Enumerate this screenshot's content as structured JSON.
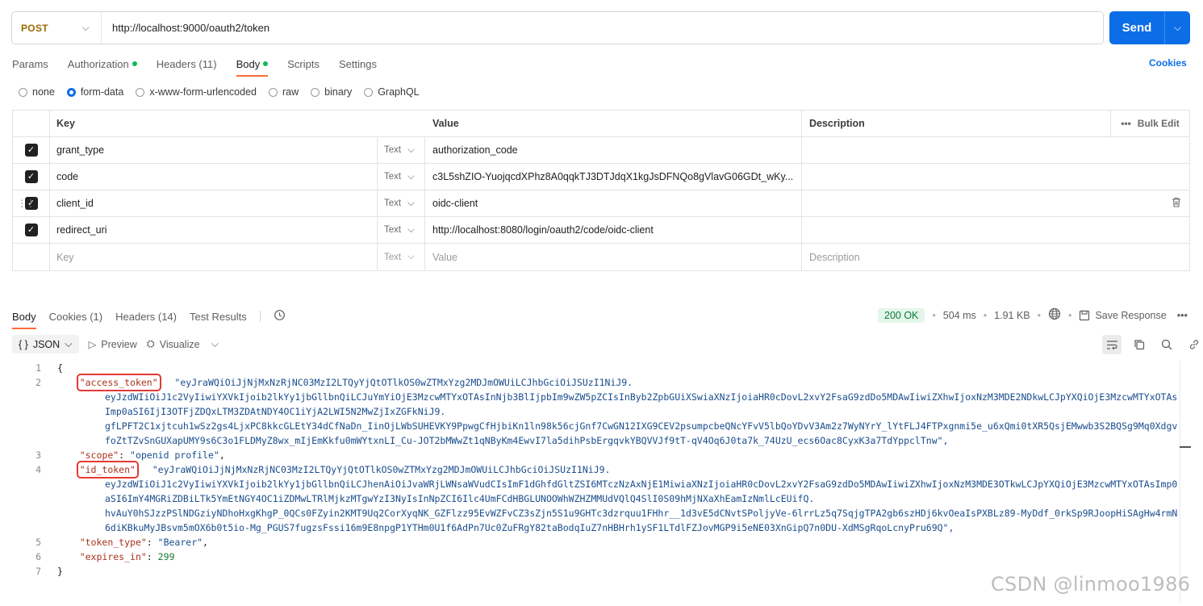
{
  "request": {
    "method": "POST",
    "url": "http://localhost:9000/oauth2/token",
    "send_label": "Send"
  },
  "request_tabs": [
    {
      "label": "Params",
      "dot": false
    },
    {
      "label": "Authorization",
      "dot": true
    },
    {
      "label": "Headers (11)",
      "dot": false
    },
    {
      "label": "Body",
      "dot": true,
      "active": true
    },
    {
      "label": "Scripts",
      "dot": false
    },
    {
      "label": "Settings",
      "dot": false
    }
  ],
  "cookies_label": "Cookies",
  "body_types": [
    {
      "label": "none",
      "selected": false
    },
    {
      "label": "form-data",
      "selected": true
    },
    {
      "label": "x-www-form-urlencoded",
      "selected": false
    },
    {
      "label": "raw",
      "selected": false
    },
    {
      "label": "binary",
      "selected": false
    },
    {
      "label": "GraphQL",
      "selected": false
    }
  ],
  "params_table": {
    "headers": {
      "key": "Key",
      "value": "Value",
      "description": "Description",
      "bulk_edit": "Bulk Edit"
    },
    "rows": [
      {
        "key": "grant_type",
        "type": "Text",
        "value": "authorization_code"
      },
      {
        "key": "code",
        "type": "Text",
        "value": "c3L5shZIO-YuojqcdXPhz8A0qqkTJ3DTJdqX1kgJsDFNQo8gVlavG06GDt_wKy..."
      },
      {
        "key": "client_id",
        "type": "Text",
        "value": "oidc-client"
      },
      {
        "key": "redirect_uri",
        "type": "Text",
        "value": "http://localhost:8080/login/oauth2/code/oidc-client"
      }
    ],
    "placeholder": {
      "key": "Key",
      "type": "Text",
      "value": "Value",
      "description": "Description"
    }
  },
  "response_tabs": [
    {
      "label": "Body",
      "active": true
    },
    {
      "label": "Cookies (1)"
    },
    {
      "label": "Headers (14)"
    },
    {
      "label": "Test Results"
    }
  ],
  "response_meta": {
    "status": "200 OK",
    "time": "504 ms",
    "size": "1.91 KB",
    "save_label": "Save Response"
  },
  "viewer": {
    "format": "JSON",
    "preview_label": "Preview",
    "visualize_label": "Visualize"
  },
  "response_json": {
    "line_numbers": [
      "1",
      "2",
      "3",
      "4",
      "5",
      "6",
      "7"
    ],
    "open_brace": "{",
    "close_brace": "}",
    "access_token_key": "\"access_token\"",
    "access_token_lines": [
      "\"eyJraWQiOiJjNjMxNzRjNC03MzI2LTQyYjQtOTlkOS0wZTMxYzg2MDJmOWUiLCJhbGciOiJSUzI1NiJ9.",
      "eyJzdWIiOiJ1c2VyIiwiYXVkIjoib2lkYy1jbGllbnQiLCJuYmYiOjE3MzcwMTYxOTAsInNjb3BlIjpbIm9wZW5pZCIsInByb2ZpbGUiXSwiaXNzIjoiaHR0cDovL2xvY2FsaG9zdDo5MDAwIiwiZXhwIjoxNzM3MDE2NDkwLCJpYXQiOjE3MzcwMTYxOTAsImp0aSI6IjI3OTFjZDQxLTM3ZDAtNDY4OC1iYjA2LWI5N2MwZjIxZGFkNiJ9.",
      "gfLPFT2C1xjtcuh1wSz2gs4LjxPC8kkcGLEtY34dCfNaDn_IinOjLWbSUHEVKY9PpwgCfHjbiKn1ln98k56cjGnf7CwGN12IXG9CEV2psumpcbeQNcYFvV5lbQoYDvV3Am2z7WyNYrY_lYtFLJ4FTPxgnmi5e_u6xQmi0tXR5QsjEMwwb3S2BQSg9Mq0XdgvfoZtTZvSnGUXapUMY9s6C3o1FLDMyZ8wx_mIjEmKkfu0mWYtxnLI_Cu-JOT2bMWwZt1qNByKm4EwvI7la5dihPsbErgqvkYBQVVJf9tT-qV4Oq6J0ta7k_74UzU_ecs6Oac8CyxK3a7TdYppclTnw\","
    ],
    "scope_key": "\"scope\"",
    "scope_value": "\"openid profile\"",
    "id_token_key": "\"id_token\"",
    "id_token_lines": [
      "\"eyJraWQiOiJjNjMxNzRjNC03MzI2LTQyYjQtOTlkOS0wZTMxYzg2MDJmOWUiLCJhbGciOiJSUzI1NiJ9.",
      "eyJzdWIiOiJ1c2VyIiwiYXVkIjoib2lkYy1jbGllbnQiLCJhenAiOiJvaWRjLWNsaWVudCIsImF1dGhfdGltZSI6MTczNzAxNjE1MiwiaXNzIjoiaHR0cDovL2xvY2FsaG9zdDo5MDAwIiwiZXhwIjoxNzM3MDE3OTkwLCJpYXQiOjE3MzcwMTYxOTAsImp0aSI6ImY4MGRiZDBiLTk5YmEtNGY4OC1iZDMwLTRlMjkzMTgwYzI3NyIsInNpZCI6Ilc4UmFCdHBGLUNOOWhWZHZMMUdVQlQ4SlI0S09hMjNXaXhEamIzNmlLcEUifQ.",
      "hvAuY0hSJzzPSlNDGziyNDhoHxgKhgP_0QCs0FZyin2KMT9Uq2CorXyqNK_GZFlzz95EvWZFvCZ3sZjn5S1u9GHTc3dzrquu1FHhr__1d3vE5dCNvtSPoljyVe-6lrrLz5q7SqjgTPA2gb6szHDj6kvOeaIsPXBLz89-MyDdf_0rkSp9RJoopHiSAgHw4rmN6diKBkuMyJBsvm5mOX6b0t5io-Mg_PGUS7fugzsFssi16m9E8npgP1YTHm0U1f6AdPn7Uc0ZuFRgY82taBodqIuZ7nHBHrh1ySF1LTdlFZJovMGP9i5eNE03XnGipQ7n0DU-XdMSgRqoLcnyPru69Q\","
    ],
    "token_type_key": "\"token_type\"",
    "token_type_value": "\"Bearer\"",
    "expires_in_key": "\"expires_in\"",
    "expires_in_value": "299"
  },
  "watermark": "CSDN @linmoo1986"
}
